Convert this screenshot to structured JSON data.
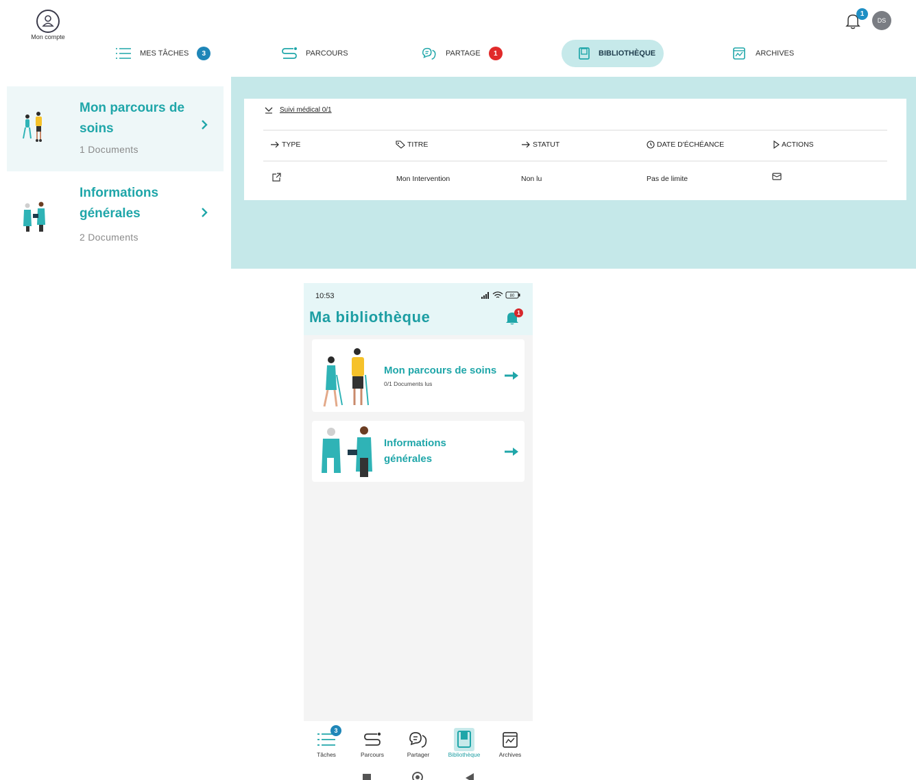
{
  "header": {
    "account_label": "Mon compte",
    "notification_count": "1",
    "avatar_initials": "DS"
  },
  "nav": {
    "items": [
      {
        "label": "MES TÂCHES",
        "badge": "3",
        "icon": "list-icon"
      },
      {
        "label": "PARCOURS",
        "icon": "route-icon"
      },
      {
        "label": "PARTAGE",
        "badge": "1",
        "icon": "share-icon"
      },
      {
        "label": "BIBLIOTHÈQUE",
        "icon": "book-icon",
        "active": true
      },
      {
        "label": "ARCHIVES",
        "icon": "archive-icon"
      }
    ]
  },
  "sidebar": {
    "categories": [
      {
        "title": "Mon parcours de soins",
        "count": "1 Documents"
      },
      {
        "title": "Informations générales",
        "count": "2 Documents"
      }
    ]
  },
  "table": {
    "group_label": "Suivi médical 0/1",
    "columns": [
      "TYPE",
      "TITRE",
      "STATUT",
      "DATE D'ÉCHÉANCE",
      "ACTIONS"
    ],
    "rows": [
      {
        "title": "Mon Intervention",
        "status": "Non lu",
        "due": "Pas de limite"
      }
    ]
  },
  "mobile": {
    "time": "10:53",
    "battery": "80",
    "title": "Ma bibliothèque",
    "notification_count": "1",
    "cards": [
      {
        "title": "Mon parcours de soins",
        "subtitle": "0/1 Documents lus"
      },
      {
        "title_line1": "Informations",
        "title_line2": "générales"
      }
    ],
    "tabs": [
      {
        "label": "Tâches",
        "badge": "3"
      },
      {
        "label": "Parcours"
      },
      {
        "label": "Partager"
      },
      {
        "label": "Bibliothèque",
        "active": true
      },
      {
        "label": "Archives"
      }
    ]
  },
  "colors": {
    "accent": "#1fa6a9",
    "band": "#c5e8e9",
    "badge_blue": "#1e86b8",
    "badge_red": "#e12a2a"
  }
}
